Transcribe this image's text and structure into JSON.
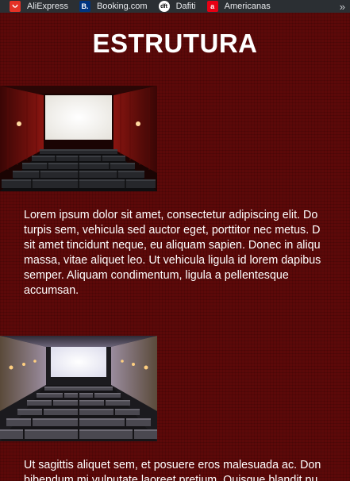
{
  "bookmarks": [
    {
      "label": "AliExpress",
      "icon": "aliexpress-icon",
      "glyph": ""
    },
    {
      "label": "Booking.com",
      "icon": "booking-icon",
      "glyph": "B."
    },
    {
      "label": "Dafiti",
      "icon": "dafiti-icon",
      "glyph": "dft"
    },
    {
      "label": "Americanas",
      "icon": "americanas-icon",
      "glyph": "a"
    }
  ],
  "bookmarks_more": "»",
  "page": {
    "title": "ESTRUTURA",
    "sections": [
      {
        "image": "cinema-hall-red-photo",
        "lines": [
          "Lorem ipsum dolor sit amet, consectetur adipiscing elit. Do",
          "turpis sem, vehicula sed auctor eget, porttitor nec metus. D",
          "sit amet tincidunt neque, eu aliquam sapien. Donec in aliqu",
          "massa, vitae aliquet leo. Ut vehicula ligula id lorem dapibus",
          "semper. Aliquam condimentum, ligula a pellentesque",
          "accumsan."
        ]
      },
      {
        "image": "cinema-hall-lounge-photo",
        "lines": [
          "Ut sagittis aliquet sem, et posuere eros malesuada ac. Don",
          "bibendum mi vulputate laoreet pretium. Quisque blandit pu"
        ]
      }
    ]
  },
  "colors": {
    "background": "#5c0909",
    "bookmarks_bar": "#2b2f33",
    "text": "#ffffff"
  }
}
